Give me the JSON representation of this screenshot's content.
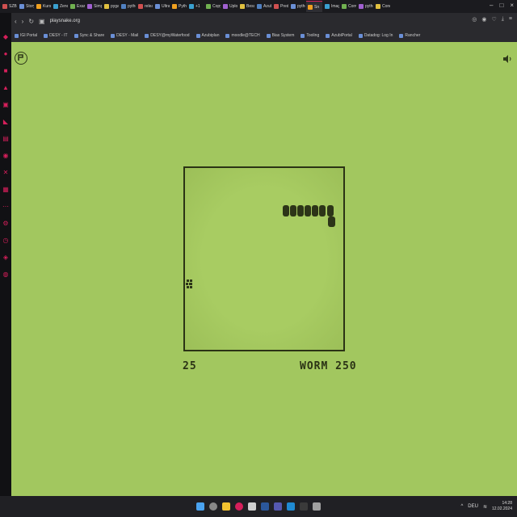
{
  "browser": {
    "tabs": [
      {
        "label": "SZB D"
      },
      {
        "label": "Storyj"
      },
      {
        "label": "Kursl"
      },
      {
        "label": "Zendes"
      },
      {
        "label": "Examc"
      },
      {
        "label": "Simpl"
      },
      {
        "label": "pygam"
      },
      {
        "label": "python"
      },
      {
        "label": "releas"
      },
      {
        "label": "Ultrali"
      },
      {
        "label": "Pytho"
      },
      {
        "label": "+1"
      },
      {
        "label": "Copy"
      },
      {
        "label": "Uploa"
      },
      {
        "label": "Beschr"
      },
      {
        "label": "Azub"
      },
      {
        "label": "Predic"
      },
      {
        "label": "pytho"
      },
      {
        "label": "Sn",
        "active": true
      },
      {
        "label": "Image"
      },
      {
        "label": "Conve"
      },
      {
        "label": "pytho"
      },
      {
        "label": "Conco"
      }
    ],
    "url": "playsnake.org",
    "bookmarks": [
      "IGI Portal",
      "DESY - IT",
      "Sync & Share",
      "DESY - Mail",
      "DESY@myWaterfood",
      "Azubiplan",
      "moodle@TECH",
      "Bias System",
      "Tooling",
      "AzubiPortal",
      "Datadog: Log In",
      "Rancher"
    ]
  },
  "game": {
    "score": "25",
    "high_score": "WORM 250"
  },
  "taskbar": {
    "lang": "DEU",
    "time": "14:28",
    "date": "12.02.2024"
  },
  "colors": {
    "background": "#a2c75f",
    "snake": "#2d3518",
    "accent": "#d61f5b"
  }
}
